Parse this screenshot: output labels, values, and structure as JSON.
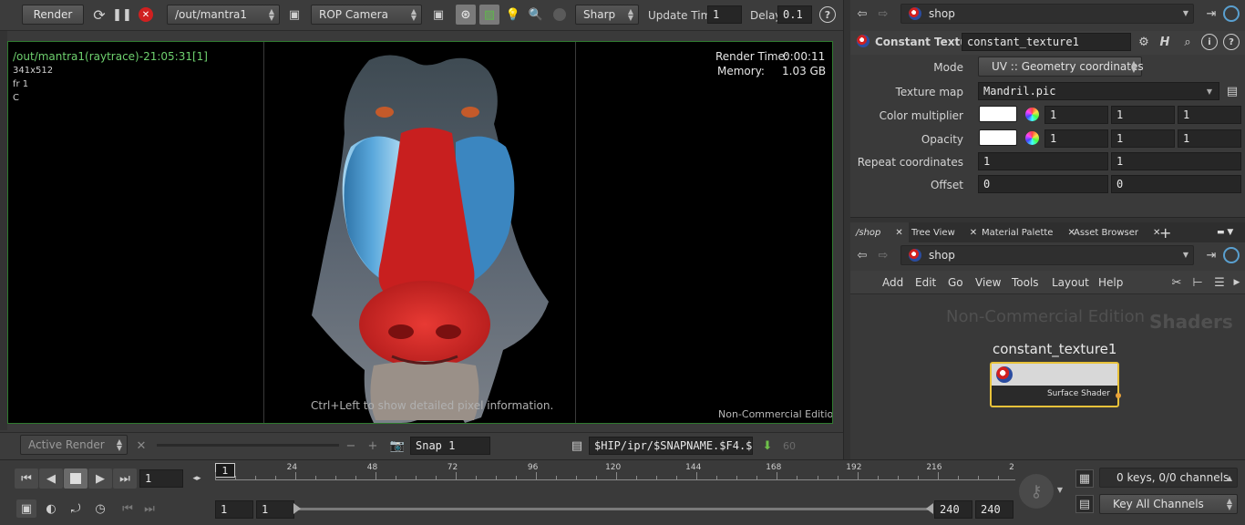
{
  "toolbar": {
    "render_label": "Render",
    "rop_path": "/out/mantra1",
    "camera": "ROP Camera",
    "sharp": "Sharp",
    "update_time_label": "Update Time",
    "update_time_value": "1",
    "delay_label": "Delay",
    "delay_value": "0.1"
  },
  "viewer": {
    "title": "/out/mantra1(raytrace)-21:05:31[1]",
    "res": "341x512",
    "frame": "fr 1",
    "channel": "C",
    "render_time_label": "Render Time:",
    "render_time_value": "0:00:11",
    "memory_label": "Memory:",
    "memory_value": "1.03 GB",
    "hint": "Ctrl+Left to show detailed pixel information.",
    "watermark": "Non-Commercial Edition"
  },
  "render_bar": {
    "active_render": "Active Render",
    "snap": "Snap 1",
    "path": "$HIP/ipr/$SNAPNAME.$F4.$S",
    "count": "60"
  },
  "timeline": {
    "frame": "1",
    "marker": "1",
    "ticks": [
      "24",
      "48",
      "72",
      "96",
      "120",
      "144",
      "168",
      "192",
      "216",
      "2"
    ],
    "start1": "1",
    "start2": "1",
    "end1": "240",
    "end2": "240",
    "keys": "0 keys, 0/0 channels",
    "key_all": "Key All Channels"
  },
  "params": {
    "network_path": "shop",
    "node_type": "Constant Texture",
    "node_name": "constant_texture1",
    "mode_label": "Mode",
    "mode_value": "UV :: Geometry coordinates",
    "texture_label": "Texture map",
    "texture_value": "Mandril.pic",
    "color_label": "Color multiplier",
    "color_values": [
      "1",
      "1",
      "1"
    ],
    "opacity_label": "Opacity",
    "opacity_values": [
      "1",
      "1",
      "1"
    ],
    "repeat_label": "Repeat coordinates",
    "repeat_values": [
      "1",
      "1"
    ],
    "offset_label": "Offset",
    "offset_values": [
      "0",
      "0"
    ]
  },
  "network": {
    "tabs": [
      "/shop",
      "Tree View",
      "Material Palette",
      "Asset Browser"
    ],
    "path": "shop",
    "menu": [
      "Add",
      "Edit",
      "Go",
      "View",
      "Tools",
      "Layout",
      "Help"
    ],
    "watermark": "Non-Commercial Edition",
    "context": "Shaders",
    "node_name": "constant_texture1",
    "node_output": "Surface Shader"
  },
  "colors": {
    "viewer_border": "#2f7a2f",
    "viewer_text": "#6ed06e",
    "node_border": "#e8c23a",
    "stop_red": "#d02020"
  }
}
